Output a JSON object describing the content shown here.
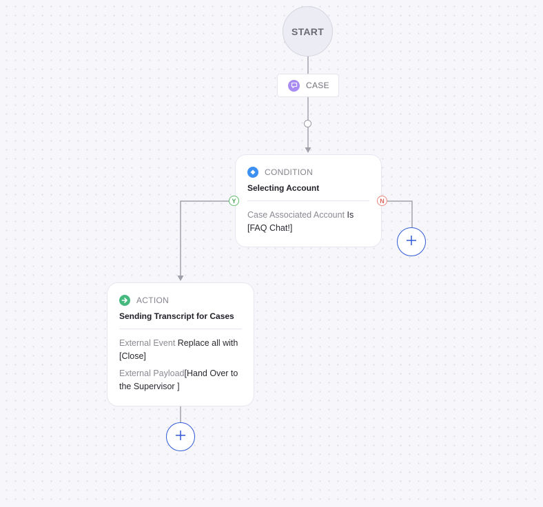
{
  "flow": {
    "start": {
      "label": "START"
    },
    "trigger": {
      "label": "CASE",
      "icon": "chat-bubble-icon",
      "color": "#a98cf2"
    },
    "condition": {
      "type_label": "CONDITION",
      "icon": "condition-diamond-icon",
      "icon_color": "#3d8ff2",
      "title": "Selecting Account",
      "rule": {
        "field": "Case Associated Account",
        "operator": "Is",
        "value": "[FAQ Chat!]"
      },
      "yes_label": "Y",
      "no_label": "N"
    },
    "action": {
      "type_label": "ACTION",
      "icon": "arrow-right-circle-icon",
      "icon_color": "#46b97e",
      "title": "Sending Transcript for Cases",
      "lines": [
        {
          "key": "External Event",
          "value": "Replace all with [Close]"
        },
        {
          "key": "External Payload",
          "value": "[Hand Over to the Supervisor ]"
        }
      ]
    },
    "add_buttons": [
      {
        "id": "add-no-branch",
        "symbol": "+"
      },
      {
        "id": "add-after-action",
        "symbol": "+"
      }
    ],
    "colors": {
      "accent": "#2e58d4",
      "yes": "#62b96c",
      "no": "#e8857c",
      "edge": "#a0a0aa"
    }
  }
}
